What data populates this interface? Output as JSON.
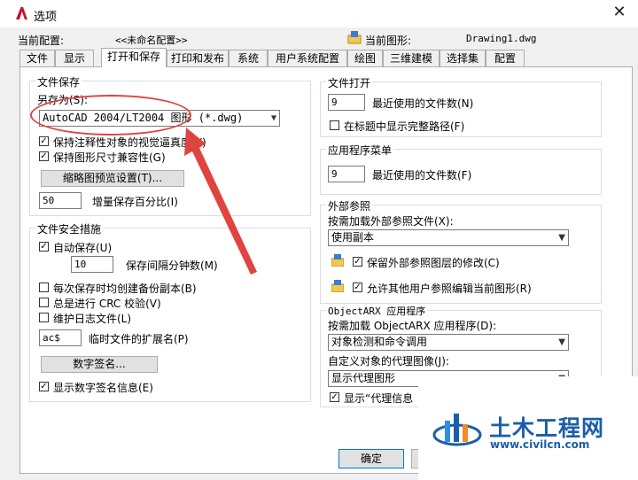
{
  "window": {
    "title": "选项",
    "app_icon": "autocad-logo-icon",
    "close_label": "✕"
  },
  "header": {
    "current_profile_label": "当前配置:",
    "current_profile_value": "<<未命名配置>>",
    "current_drawing_label": "当前图形:",
    "current_drawing_value": "Drawing1.dwg"
  },
  "tabs": [
    {
      "label": "文件"
    },
    {
      "label": "显示"
    },
    {
      "label": "打开和保存",
      "active": true
    },
    {
      "label": "打印和发布"
    },
    {
      "label": "系统"
    },
    {
      "label": "用户系统配置"
    },
    {
      "label": "绘图"
    },
    {
      "label": "三维建模"
    },
    {
      "label": "选择集"
    },
    {
      "label": "配置"
    }
  ],
  "file_save": {
    "title": "文件保存",
    "save_as_label": "另存为(S):",
    "save_as_value": "AutoCAD 2004/LT2004 图形 (*.dwg)",
    "maintain_visual_fidelity": {
      "label": "保持注释性对象的视觉逼真度(Y)",
      "checked": true
    },
    "maintain_drawing_size": {
      "label": "保持图形尺寸兼容性(G)",
      "checked": true
    },
    "thumbnail_button": "缩略图预览设置(T)...",
    "incremental_save_value": "50",
    "incremental_save_label": "增量保存百分比(I)"
  },
  "file_safety": {
    "title": "文件安全措施",
    "autosave": {
      "label": "自动保存(U)",
      "checked": true
    },
    "minutes_value": "10",
    "minutes_label": "保存间隔分钟数(M)",
    "backup_copy": {
      "label": "每次保存时均创建备份副本(B)",
      "checked": false
    },
    "crc_check": {
      "label": "总是进行 CRC 校验(V)",
      "checked": false
    },
    "log_file": {
      "label": "维护日志文件(L)",
      "checked": false
    },
    "temp_ext_value": "ac$",
    "temp_ext_label": "临时文件的扩展名(P)",
    "digital_sig_button": "数字签名...",
    "display_sig": {
      "label": "显示数字签名信息(E)",
      "checked": true
    }
  },
  "file_open": {
    "title": "文件打开",
    "recent_files_value": "9",
    "recent_files_label": "最近使用的文件数(N)",
    "full_path": {
      "label": "在标题中显示完整路径(F)",
      "checked": false
    }
  },
  "app_menu": {
    "title": "应用程序菜单",
    "recent_files_value": "9",
    "recent_files_label": "最近使用的文件数(F)"
  },
  "xref": {
    "title": "外部参照",
    "demand_load_label": "按需加载外部参照文件(X):",
    "demand_load_value": "使用副本",
    "retain_changes": {
      "label": "保留外部参照图层的修改(C)",
      "checked": true
    },
    "allow_edit": {
      "label": "允许其他用户参照编辑当前图形(R)",
      "checked": true
    }
  },
  "objectarx": {
    "title": "ObjectARX 应用程序",
    "demand_load_label": "按需加载 ObjectARX 应用程序(D):",
    "demand_load_value": "对象检测和命令调用",
    "proxy_label": "自定义对象的代理图像(J):",
    "proxy_value": "显示代理图形",
    "show_proxy": {
      "label": "显示“代理信息",
      "checked": true
    }
  },
  "footer": {
    "ok_button": "确定"
  },
  "annotation": {
    "color": "#e0443e"
  },
  "watermark": {
    "cn_text": "土木工程网",
    "url": "www.civilcn.com"
  }
}
